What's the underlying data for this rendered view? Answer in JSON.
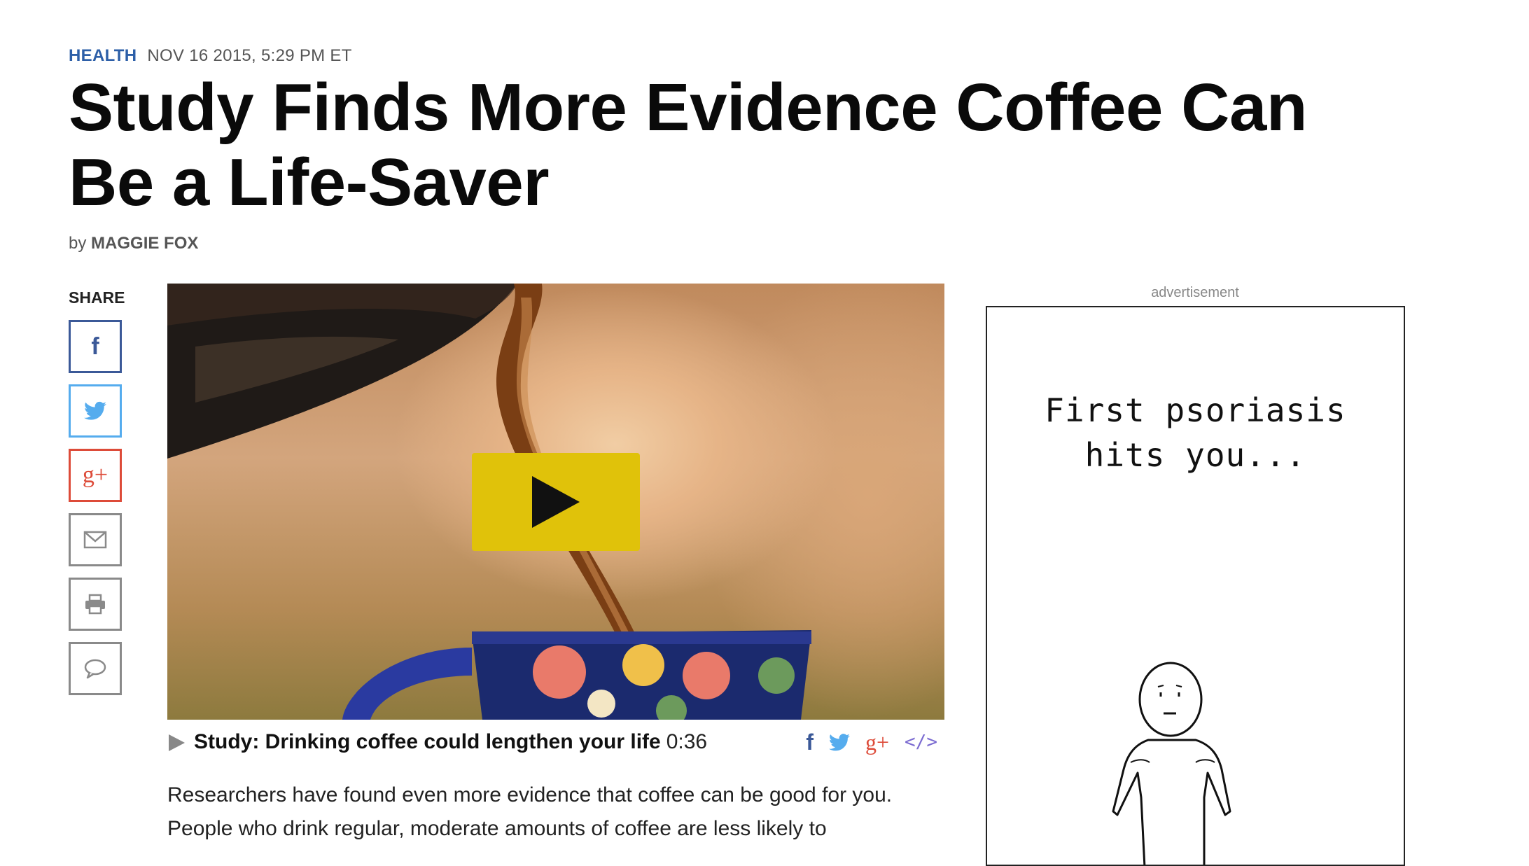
{
  "article": {
    "section": "HEALTH",
    "date": "NOV 16 2015, 5:29 PM ET",
    "headline": "Study Finds More Evidence Coffee Can Be a Life-Saver",
    "byline_prefix": "by",
    "author": "MAGGIE FOX",
    "body_text": "Researchers have found even more evidence that coffee can be good for you. People who drink regular, moderate amounts of coffee are less likely to"
  },
  "share": {
    "label": "SHARE",
    "buttons": [
      {
        "name": "facebook",
        "icon": "facebook-icon",
        "color": "#3b5998"
      },
      {
        "name": "twitter",
        "icon": "twitter-icon",
        "color": "#55acee"
      },
      {
        "name": "google-plus",
        "icon": "google-plus-icon",
        "color": "#dd4b39"
      },
      {
        "name": "email",
        "icon": "envelope-icon",
        "color": "#8a8a8a"
      },
      {
        "name": "print",
        "icon": "printer-icon",
        "color": "#8a8a8a"
      },
      {
        "name": "comment",
        "icon": "speech-bubble-icon",
        "color": "#8a8a8a"
      }
    ]
  },
  "video": {
    "title": "Study: Drinking coffee could lengthen your life",
    "duration": "0:36",
    "play_button_color": "#e0c20a"
  },
  "caption_share": {
    "facebook": "f",
    "google_plus": "g+",
    "embed": "</>"
  },
  "ad": {
    "label": "advertisement",
    "line1": "First psoriasis",
    "line2": "hits you..."
  }
}
